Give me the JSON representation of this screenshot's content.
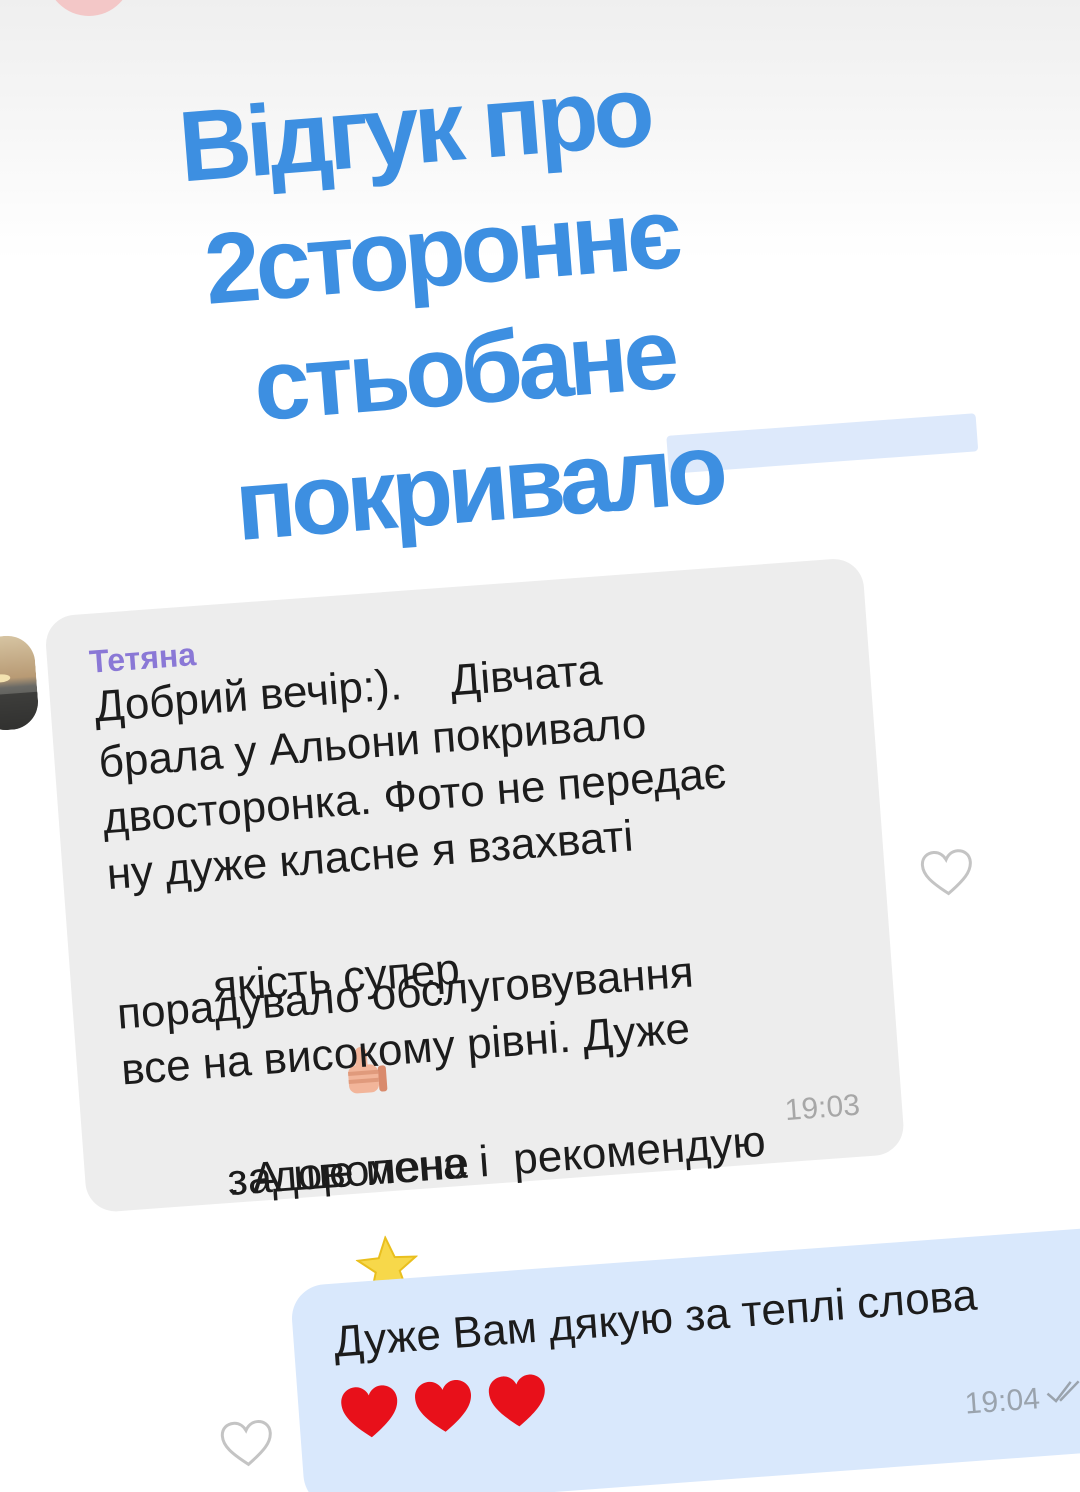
{
  "title": {
    "line1": "Відгук про",
    "line2": "2стороннє",
    "line3": "стьобане",
    "line4": "покривало"
  },
  "incoming": {
    "sender": "Тетяна",
    "lines": [
      "Добрий вечір:).    Дівчата",
      "брала у Альони покривало",
      "двосторонка. Фото не передає",
      "ну дуже класне я взахваті",
      "якість супер",
      ". А ще мене",
      "порадувало обслуговування",
      "все на високому рівні. Дуже",
      "задоволена і  рекомендую"
    ],
    "time": "19:03",
    "emoji_thumb": "thumbs-up",
    "emoji_star": "star"
  },
  "outgoing": {
    "text": "Дуже Вам дякую за теплі слова",
    "hearts": [
      "red-heart",
      "red-heart",
      "red-heart"
    ],
    "time": "19:04",
    "status": "read"
  },
  "colors": {
    "title": "#3d8fe1",
    "incoming_bubble": "#ededed",
    "outgoing_bubble": "#d9e8fc",
    "sender_name": "#8a78d6",
    "heart": "#e8101a"
  }
}
